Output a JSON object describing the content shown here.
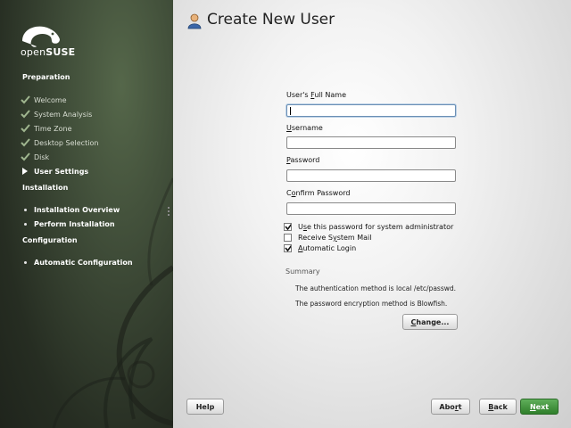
{
  "brand": {
    "open": "open",
    "suse": "SUSE"
  },
  "sidebar": {
    "sections": [
      {
        "title": "Preparation"
      },
      {
        "title": "Installation"
      },
      {
        "title": "Configuration"
      }
    ],
    "preparation_steps": [
      {
        "label": "Welcome",
        "icon": "check-icon"
      },
      {
        "label": "System Analysis",
        "icon": "check-icon"
      },
      {
        "label": "Time Zone",
        "icon": "check-icon"
      },
      {
        "label": "Desktop Selection",
        "icon": "check-icon"
      },
      {
        "label": "Disk",
        "icon": "check-icon"
      },
      {
        "label": "User Settings",
        "icon": "arrow-right-icon"
      }
    ],
    "installation_steps": [
      {
        "label": "Installation Overview",
        "icon": "bullet-icon"
      },
      {
        "label": "Perform Installation",
        "icon": "bullet-icon"
      }
    ],
    "configuration_steps": [
      {
        "label": "Automatic Configuration",
        "icon": "bullet-icon"
      }
    ]
  },
  "page": {
    "title": "Create New User",
    "icon": "user-icon"
  },
  "form": {
    "full_name": {
      "label_pre": "User's ",
      "label_key": "F",
      "label_post": "ull Name",
      "value": ""
    },
    "username": {
      "label_pre": "",
      "label_key": "U",
      "label_post": "sername",
      "value": ""
    },
    "password": {
      "label_pre": "",
      "label_key": "P",
      "label_post": "assword",
      "value": ""
    },
    "confirm": {
      "label_pre": "C",
      "label_key": "o",
      "label_post": "nfirm Password",
      "value": ""
    },
    "checkboxes": [
      {
        "label_pre": "U",
        "label_key": "s",
        "label_post": "e this password for system administrator",
        "checked": true
      },
      {
        "label_pre": "Receive S",
        "label_key": "y",
        "label_post": "stem Mail",
        "checked": false
      },
      {
        "label_pre": "",
        "label_key": "A",
        "label_post": "utomatic Login",
        "checked": true
      }
    ]
  },
  "summary": {
    "heading": "Summary",
    "line1": "The authentication method is local /etc/passwd.",
    "line2": "The password encryption method is Blowfish.",
    "change_button": {
      "pre": "",
      "key": "C",
      "post": "hange..."
    }
  },
  "buttons": {
    "help": "Help",
    "abort": {
      "pre": "Abo",
      "key": "r",
      "post": "t"
    },
    "back": {
      "pre": "",
      "key": "B",
      "post": "ack"
    },
    "next": {
      "pre": "",
      "key": "N",
      "post": "ext"
    }
  },
  "colors": {
    "accent": "#3a8a35",
    "sidebar_bg": "#3f4c38",
    "check": "#9fb58f"
  }
}
